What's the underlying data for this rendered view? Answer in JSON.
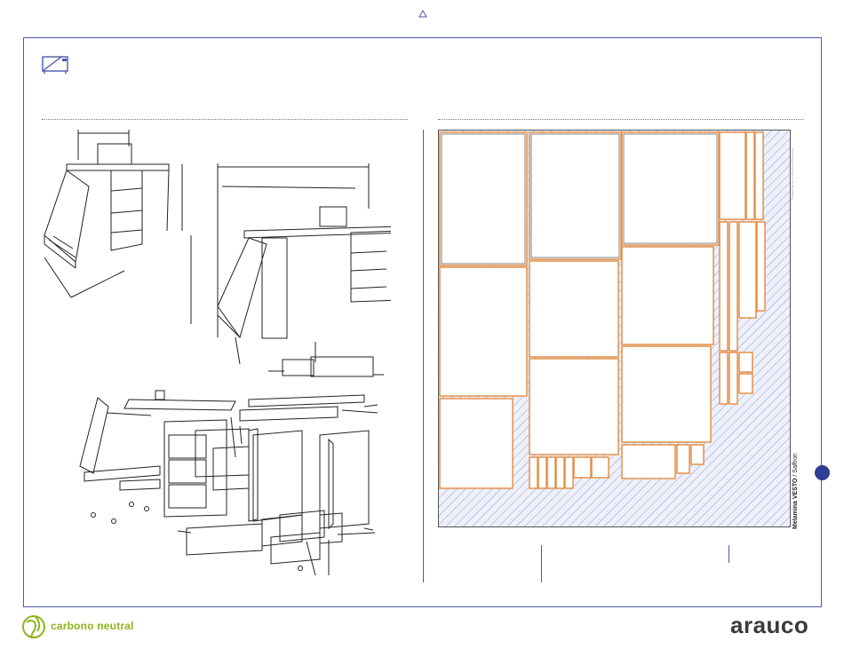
{
  "sheet": {
    "brand": "Melamina VESTO",
    "color": "Saffron",
    "watermark": "Esquema no a escala referencial"
  },
  "footer": {
    "left_logo_text": "carbono neutral",
    "right_logo_text": "arauco"
  },
  "colors": {
    "frame": "#4b5aa5",
    "piece_edge": "#e38a3c",
    "hatch": "#7f87c6",
    "green": "#8fb31e"
  },
  "icons": [
    "up-triangle-icon",
    "desk-icon",
    "globe-leaf-icon"
  ]
}
